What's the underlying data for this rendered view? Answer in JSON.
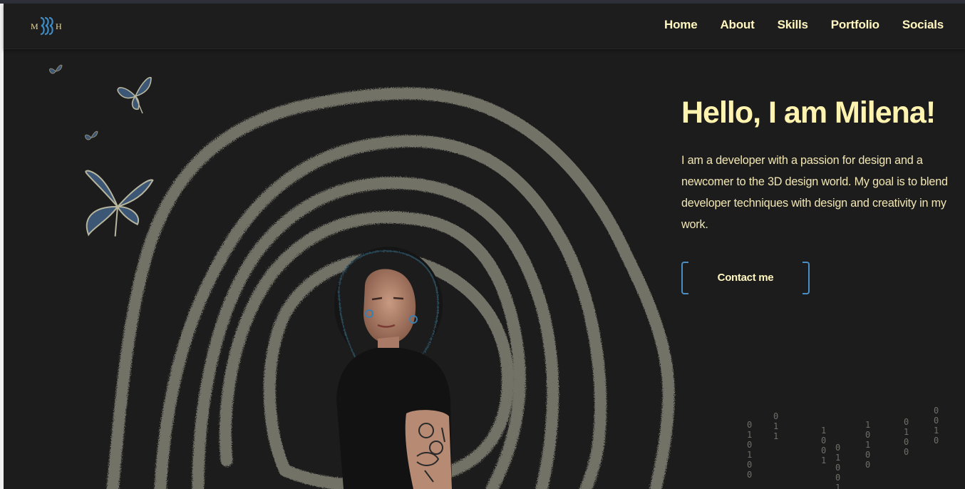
{
  "logo": {
    "letters": [
      "M",
      "H"
    ]
  },
  "nav": {
    "items": [
      {
        "label": "Home"
      },
      {
        "label": "About"
      },
      {
        "label": "Skills"
      },
      {
        "label": "Portfolio"
      },
      {
        "label": "Socials"
      }
    ]
  },
  "hero": {
    "title": "Hello, I am Milena!",
    "description": "I am a developer with a passion for design and a newcomer to the 3D design world. My goal is to blend developer techniques with design and creativity in my work.",
    "cta_label": "Contact me"
  },
  "binary_rain": [
    "0 1 1",
    "0 1 0 1 0 0",
    "1 0 0 1",
    "0 1 0 0 1",
    "1 0 1 0 0",
    "0 1 0 0",
    "0 0 1 0"
  ],
  "colors": {
    "background": "#1c1c1c",
    "nav_text": "#fff6c0",
    "accent_blue": "#4a8ec4",
    "scribble": "#7d7b70"
  }
}
